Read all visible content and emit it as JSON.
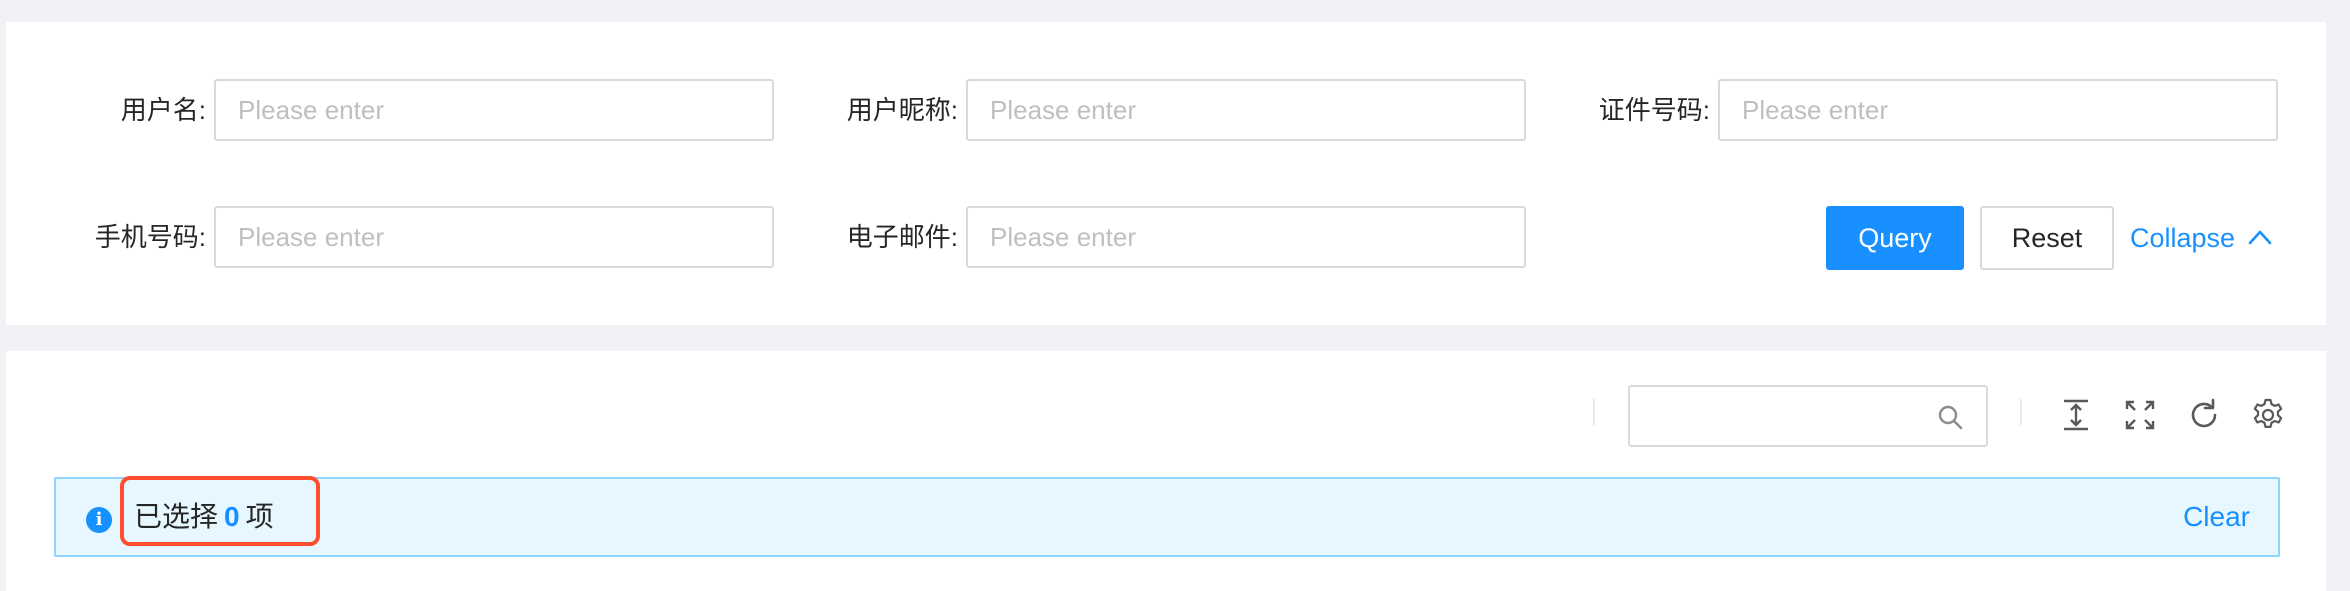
{
  "search_form": {
    "fields": [
      {
        "label": "用户名:",
        "placeholder": "Please enter",
        "value": ""
      },
      {
        "label": "用户昵称:",
        "placeholder": "Please enter",
        "value": ""
      },
      {
        "label": "证件号码:",
        "placeholder": "Please enter",
        "value": ""
      },
      {
        "label": "手机号码:",
        "placeholder": "Please enter",
        "value": ""
      },
      {
        "label": "电子邮件:",
        "placeholder": "Please enter",
        "value": ""
      }
    ],
    "query_label": "Query",
    "reset_label": "Reset",
    "collapse_label": "Collapse"
  },
  "table_toolbar": {
    "search_value": "",
    "icons": [
      "search-icon",
      "column-height-icon",
      "fullscreen-icon",
      "reload-icon",
      "setting-icon"
    ]
  },
  "selection_alert": {
    "prefix": "已选择",
    "count": "0",
    "suffix": "项",
    "clear_label": "Clear",
    "info_glyph": "i"
  },
  "colors": {
    "primary": "#1890ff",
    "page_background": "#f0f2f5",
    "alert_background": "#e6f7ff",
    "alert_border": "#91d5ff",
    "highlight": "#ff4d2e"
  }
}
